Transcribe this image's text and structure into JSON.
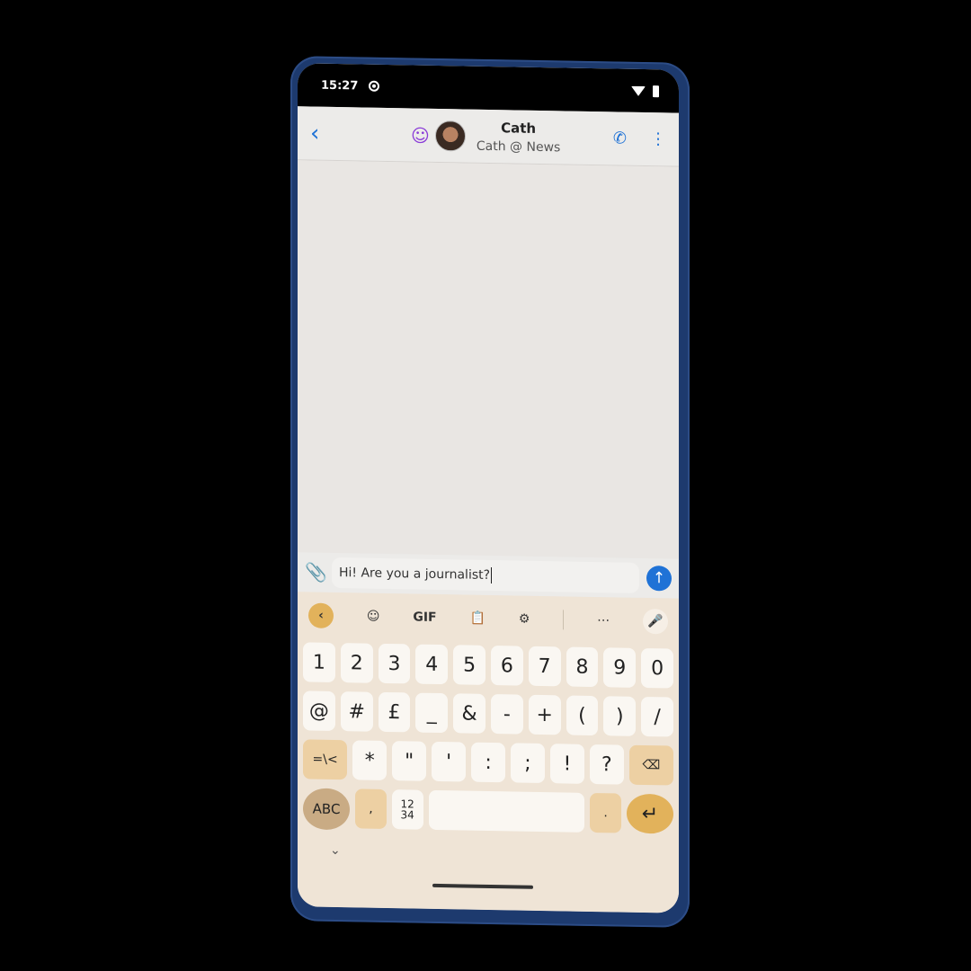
{
  "status_bar": {
    "time": "15:27"
  },
  "header": {
    "contact_name": "Cath",
    "contact_subtitle": "Cath @ News"
  },
  "composer": {
    "message_text": "Hi! Are you a journalist?"
  },
  "keyboard": {
    "toolbar": {
      "gif_label": "GIF"
    },
    "rows": [
      [
        "1",
        "2",
        "3",
        "4",
        "5",
        "6",
        "7",
        "8",
        "9",
        "0"
      ],
      [
        "@",
        "#",
        "£",
        "_",
        "&",
        "-",
        "+",
        "(",
        ")",
        "/"
      ],
      [
        "=\\<",
        "*",
        "\"",
        "'",
        ":",
        ";",
        "!",
        "?"
      ]
    ],
    "bottom": {
      "abc_label": "ABC",
      "comma": ",",
      "numpad_label": "12\n34",
      "period": "."
    }
  },
  "colors": {
    "accent": "#1f72d6",
    "key_mod": "#edd0a3",
    "enter": "#e2b25b"
  }
}
